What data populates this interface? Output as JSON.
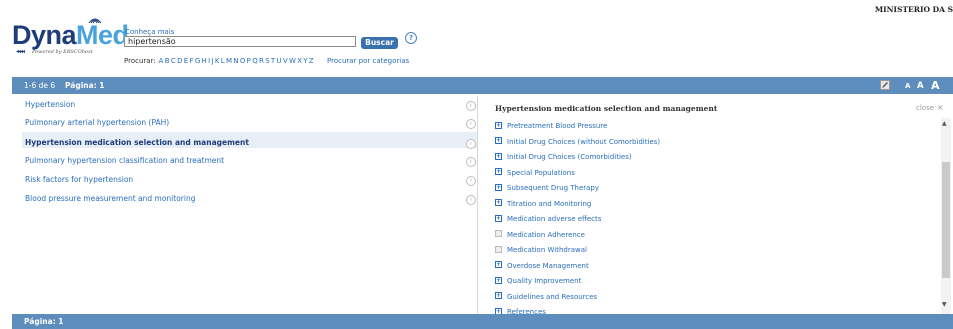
{
  "header": {
    "logo_part1": "Dyna",
    "logo_part2": "Med",
    "logo_tagline": "Powered by EBSCOhost",
    "conheca_mais": "Conheça mais",
    "search_value": "hipertensão",
    "search_button": "Buscar",
    "help": "?",
    "procurar_label": "Procurar:",
    "letters": [
      "A",
      "B",
      "C",
      "D",
      "E",
      "F",
      "G",
      "H",
      "I",
      "J",
      "K",
      "L",
      "M",
      "N",
      "O",
      "P",
      "Q",
      "R",
      "S",
      "T",
      "U",
      "V",
      "W",
      "X",
      "Y",
      "Z"
    ],
    "procurar_categorias": "Procurar por categorias",
    "institution": "MINISTERIO DA S"
  },
  "results_bar": {
    "range": "1-6 de 6",
    "pagina": "Página: 1",
    "font_small": "A",
    "font_medium": "A",
    "font_large": "A"
  },
  "results": [
    {
      "label": "Hypertension"
    },
    {
      "label": "Pulmonary arterial hypertension (PAH)"
    },
    {
      "label": "Hypertension medication selection and management"
    },
    {
      "label": "Pulmonary hypertension classification and treatment"
    },
    {
      "label": "Risk factors for hypertension"
    },
    {
      "label": "Blood pressure measurement and monitoring"
    }
  ],
  "detail": {
    "title": "Hypertension medication selection and management",
    "close": "close",
    "close_x": "×",
    "sections": [
      {
        "label": "Pretreatment Blood Pressure",
        "expandable": true
      },
      {
        "label": "Initial Drug Choices (without Comorbidities)",
        "expandable": true
      },
      {
        "label": "Initial Drug Choices (Comorbidities)",
        "expandable": true
      },
      {
        "label": "Special Populations",
        "expandable": true
      },
      {
        "label": "Subsequent Drug Therapy",
        "expandable": true
      },
      {
        "label": "Titration and Monitoring",
        "expandable": true
      },
      {
        "label": "Medication adverse effects",
        "expandable": true
      },
      {
        "label": "Medication Adherence",
        "expandable": false
      },
      {
        "label": "Medication Withdrawal",
        "expandable": false
      },
      {
        "label": "Overdose Management",
        "expandable": true
      },
      {
        "label": "Quality Improvement",
        "expandable": true
      },
      {
        "label": "Guidelines and Resources",
        "expandable": true
      },
      {
        "label": "References",
        "expandable": true
      }
    ]
  },
  "bottom_bar": {
    "pagina": "Página: 1"
  },
  "colors": {
    "bar_blue": "#5d8dbc",
    "link_blue": "#2a6ebb",
    "logo_dark": "#1f3d7a",
    "logo_light": "#4aa3dd",
    "button_blue": "#3a72b0"
  }
}
